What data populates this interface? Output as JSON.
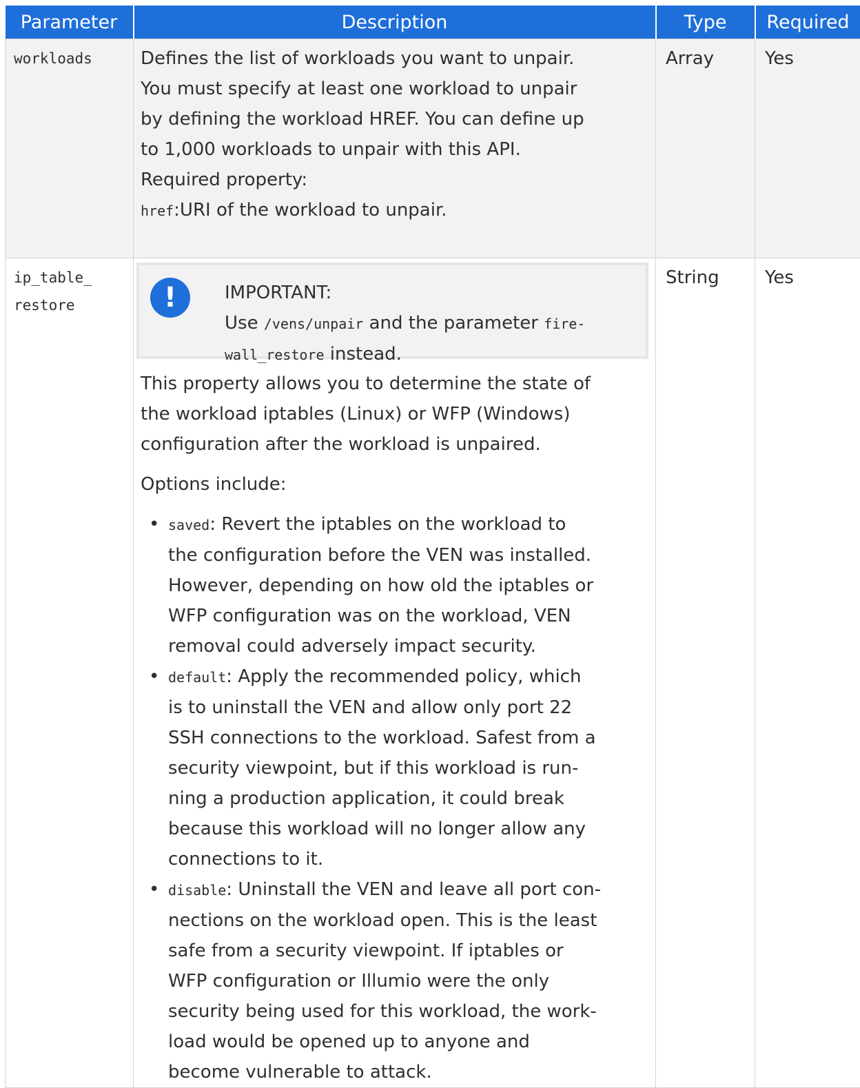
{
  "table": {
    "headers": [
      "Parameter",
      "Description",
      "Type",
      "Required"
    ],
    "rows": [
      {
        "parameter": "workloads",
        "description_lines": [
          "Defines the list of workloads you want to unpair.",
          "You must specify at least one workload to unpair",
          "by defining the workload HREF. You can define up",
          "to 1,000 workloads to unpair with this API.",
          "Required property:"
        ],
        "href_code": "href",
        "href_text": ":URI of the workload to unpair.",
        "type": "Array",
        "required": "Yes"
      },
      {
        "parameter_line1": "ip_table_",
        "parameter_line2": "restore",
        "note": {
          "title": "IMPORTANT:",
          "pre": "Use ",
          "code1": "/vens/unpair",
          "mid": " and the parameter ",
          "code2a": "fire-",
          "code2b": "wall_restore",
          "post": " instead."
        },
        "intro_lines": [
          "This property allows you to determine the state of",
          "the workload iptables (Linux) or WFP (Windows)",
          "configuration after the workload is unpaired."
        ],
        "options_label": "Options include:",
        "options": [
          {
            "code": "saved",
            "lines": [
              ": Revert the iptables on the workload to",
              "the configuration before the VEN was installed.",
              "However, depending on how old the iptables or",
              "WFP configuration was on the workload, VEN",
              "removal could adversely impact security."
            ]
          },
          {
            "code": "default",
            "lines": [
              ": Apply the recommended policy, which",
              "is to uninstall the VEN and allow only port 22",
              "SSH connections to the workload. Safest from a",
              "security viewpoint, but if this workload is run-",
              "ning a production application, it could break",
              "because this workload will no longer allow any",
              "connections to it."
            ]
          },
          {
            "code": "disable",
            "lines": [
              ": Uninstall the VEN and leave all port con-",
              "nections on the workload open. This is the least",
              "safe from a security viewpoint. If iptables or",
              "WFP configuration or Illumio were the only",
              "security being used for this workload, the work-",
              "load would be opened up to anyone and",
              "become vulnerable to attack."
            ]
          }
        ],
        "type": "String",
        "required": "Yes"
      }
    ]
  },
  "colors": {
    "header_bg": "#1e6fd9",
    "row_shade": "#f2f2f2",
    "icon_bg": "#1e6fd9"
  },
  "icons": {
    "note_icon": "exclamation-circle"
  }
}
